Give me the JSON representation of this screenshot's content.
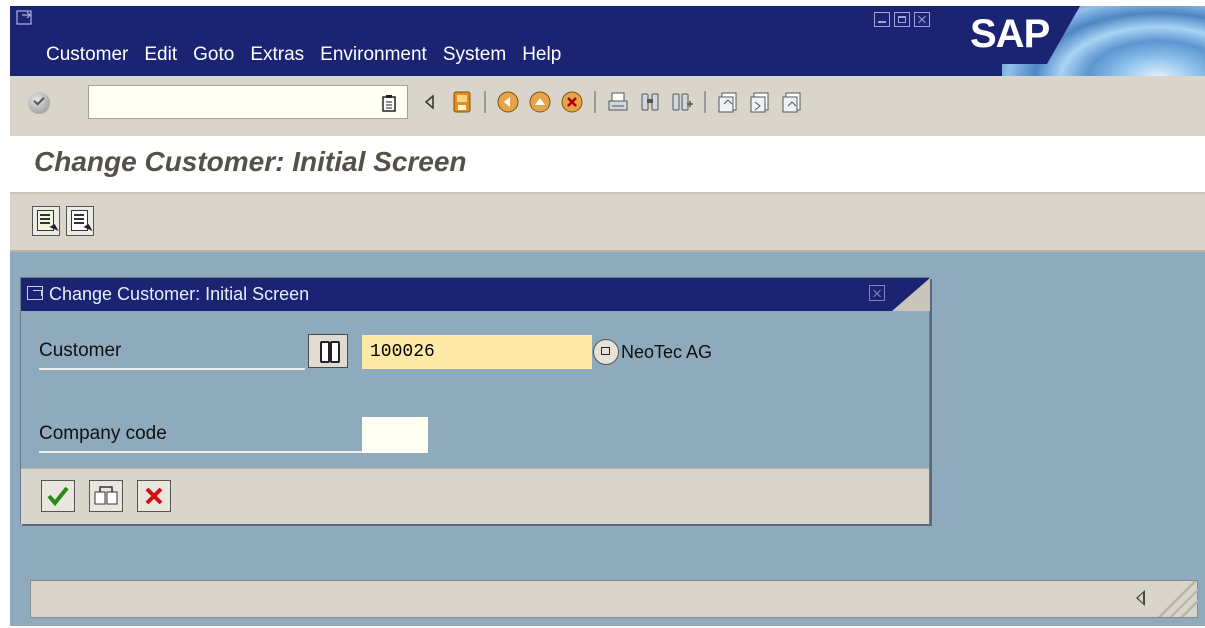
{
  "menubar": {
    "items": [
      "Customer",
      "Edit",
      "Goto",
      "Extras",
      "Environment",
      "System",
      "Help"
    ]
  },
  "brand": {
    "logo_text": "SAP"
  },
  "toolbar": {
    "command_field_value": "",
    "icons": [
      "enter-icon",
      "back-icon",
      "save-icon",
      "back-nav-icon",
      "exit-icon",
      "cancel-icon",
      "print-icon",
      "find-icon",
      "find-next-icon",
      "first-page-icon",
      "previous-page-icon",
      "next-page-icon"
    ]
  },
  "screen": {
    "title": "Change Customer: Initial Screen"
  },
  "dialog": {
    "title": "Change Customer: Initial Screen",
    "customer_label": "Customer",
    "customer_value": "100026",
    "customer_name": "NeoTec AG",
    "company_code_label": "Company code",
    "company_code_value": ""
  },
  "colors": {
    "title_bar": "#1a2472",
    "background": "#8fa9bd",
    "toolbar": "#d9d5cb",
    "required_field": "#fee9a6"
  }
}
